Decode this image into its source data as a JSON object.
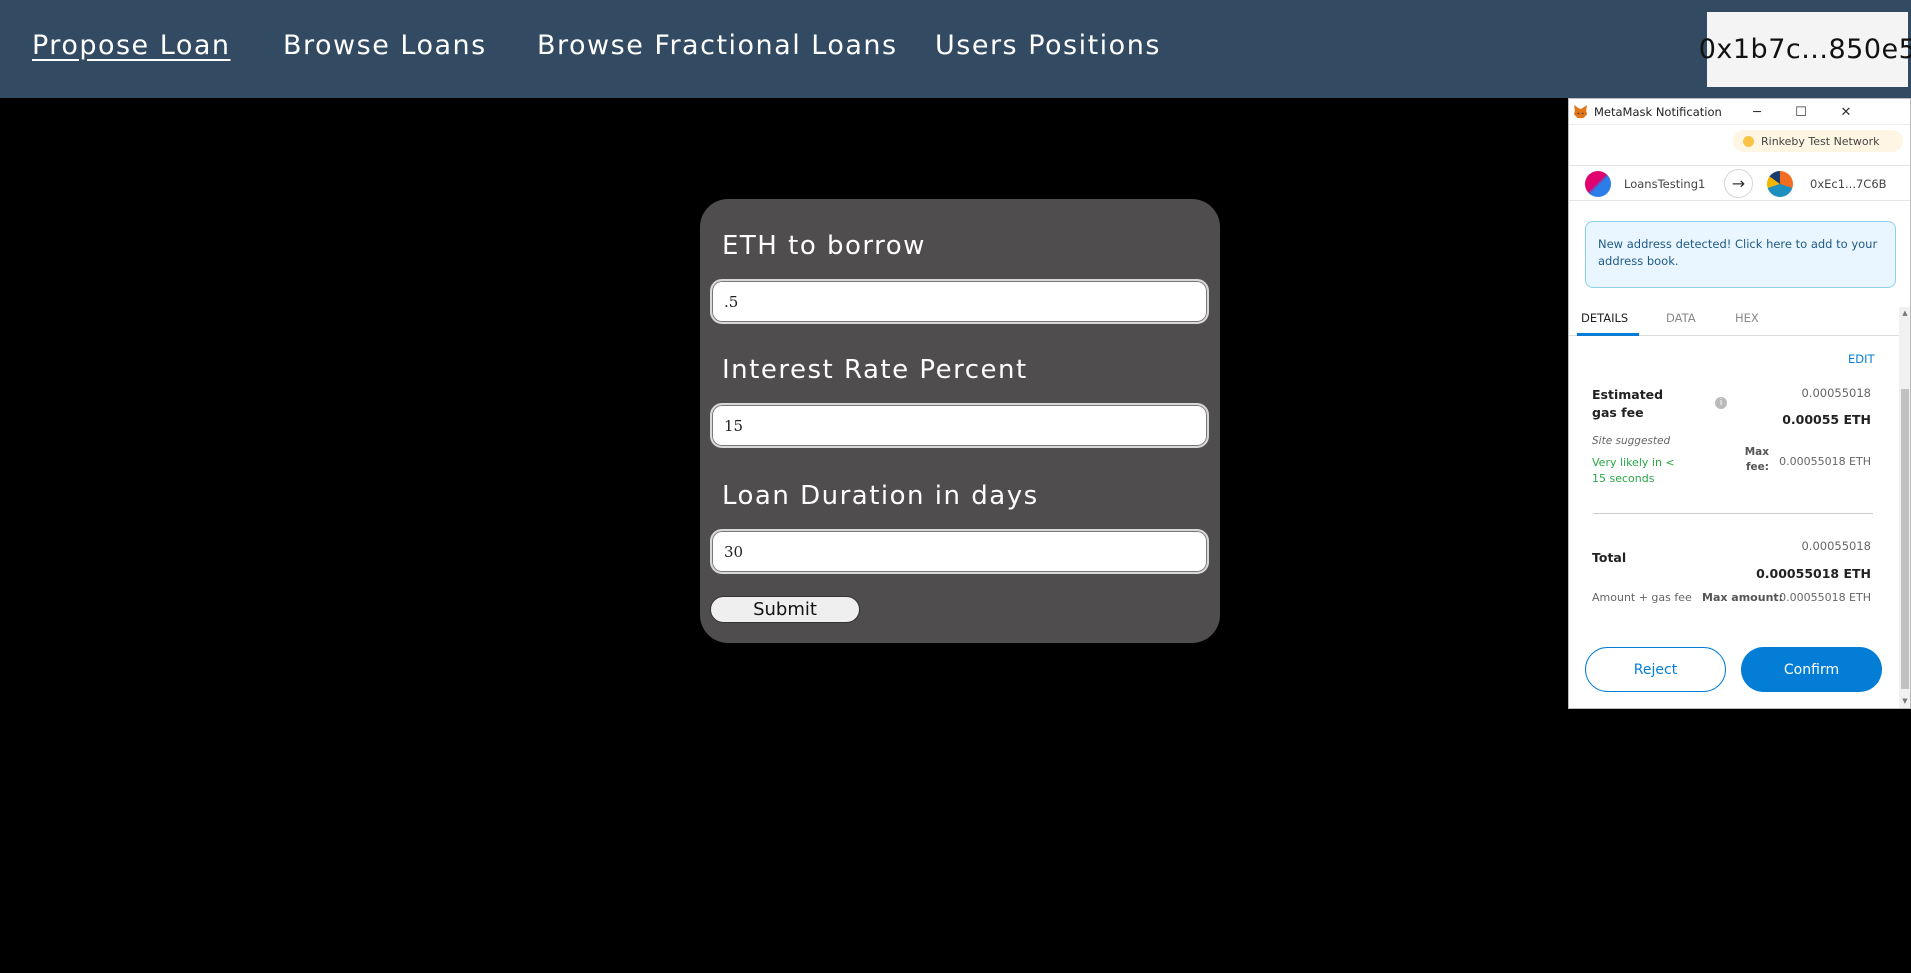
{
  "nav": {
    "links": [
      "Propose Loan",
      "Browse Loans",
      "Browse Fractional Loans",
      "Users Positions"
    ],
    "wallet_address": "0x1b7c...850e5"
  },
  "form": {
    "eth_label": "ETH to borrow",
    "eth_value": ".5",
    "rate_label": "Interest Rate Percent",
    "rate_value": "15",
    "duration_label": "Loan Duration in days",
    "duration_value": "30",
    "submit_label": "Submit"
  },
  "metamask": {
    "title": "MetaMask Notification",
    "network": "Rinkeby Test Network",
    "from_account": "LoansTesting1",
    "to_account": "0xEc1...7C6B",
    "notice": "New address detected! Click here to add to your address book.",
    "tabs": [
      "DETAILS",
      "DATA",
      "HEX"
    ],
    "edit_label": "EDIT",
    "gas_label": "Estimated gas fee",
    "gas_value_small": "0.00055018",
    "gas_value_bold": "0.00055 ETH",
    "site_suggested": "Site suggested",
    "likely_text": "Very likely in < 15 seconds",
    "max_fee_label": "Max fee:",
    "max_fee_value": "0.00055018 ETH",
    "total_label": "Total",
    "total_value_small": "0.00055018",
    "total_value_bold": "0.00055018 ETH",
    "amount_gas_label": "Amount + gas fee",
    "max_amount_label": "Max amount:",
    "max_amount_value": "0.00055018 ETH",
    "reject_label": "Reject",
    "confirm_label": "Confirm",
    "colors": {
      "primary": "#037dd6",
      "success": "#28a745",
      "network_dot": "#f8c444"
    }
  },
  "colors": {
    "navbar": "#324a62",
    "card": "#4f4d4d",
    "background": "#000000"
  }
}
